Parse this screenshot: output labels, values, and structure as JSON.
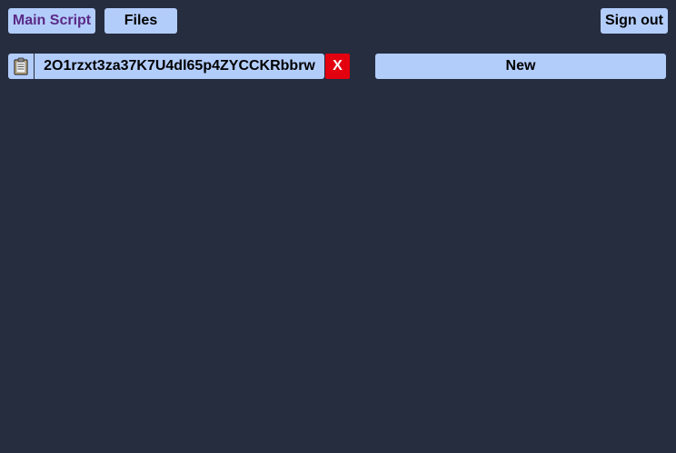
{
  "nav": {
    "main_script_label": "Main Script",
    "files_label": "Files",
    "sign_out_label": "Sign out"
  },
  "scripts": [
    {
      "name": "2O1rzxt3za37K7U4dl65p4ZYCCKRbbrw",
      "copy_icon": "clipboard-icon",
      "delete_label": "X"
    }
  ],
  "new_label": "New",
  "colors": {
    "background": "#252d3f",
    "button": "#b3cdfb",
    "active_text": "#5a2a86",
    "delete": "#e3000f"
  }
}
